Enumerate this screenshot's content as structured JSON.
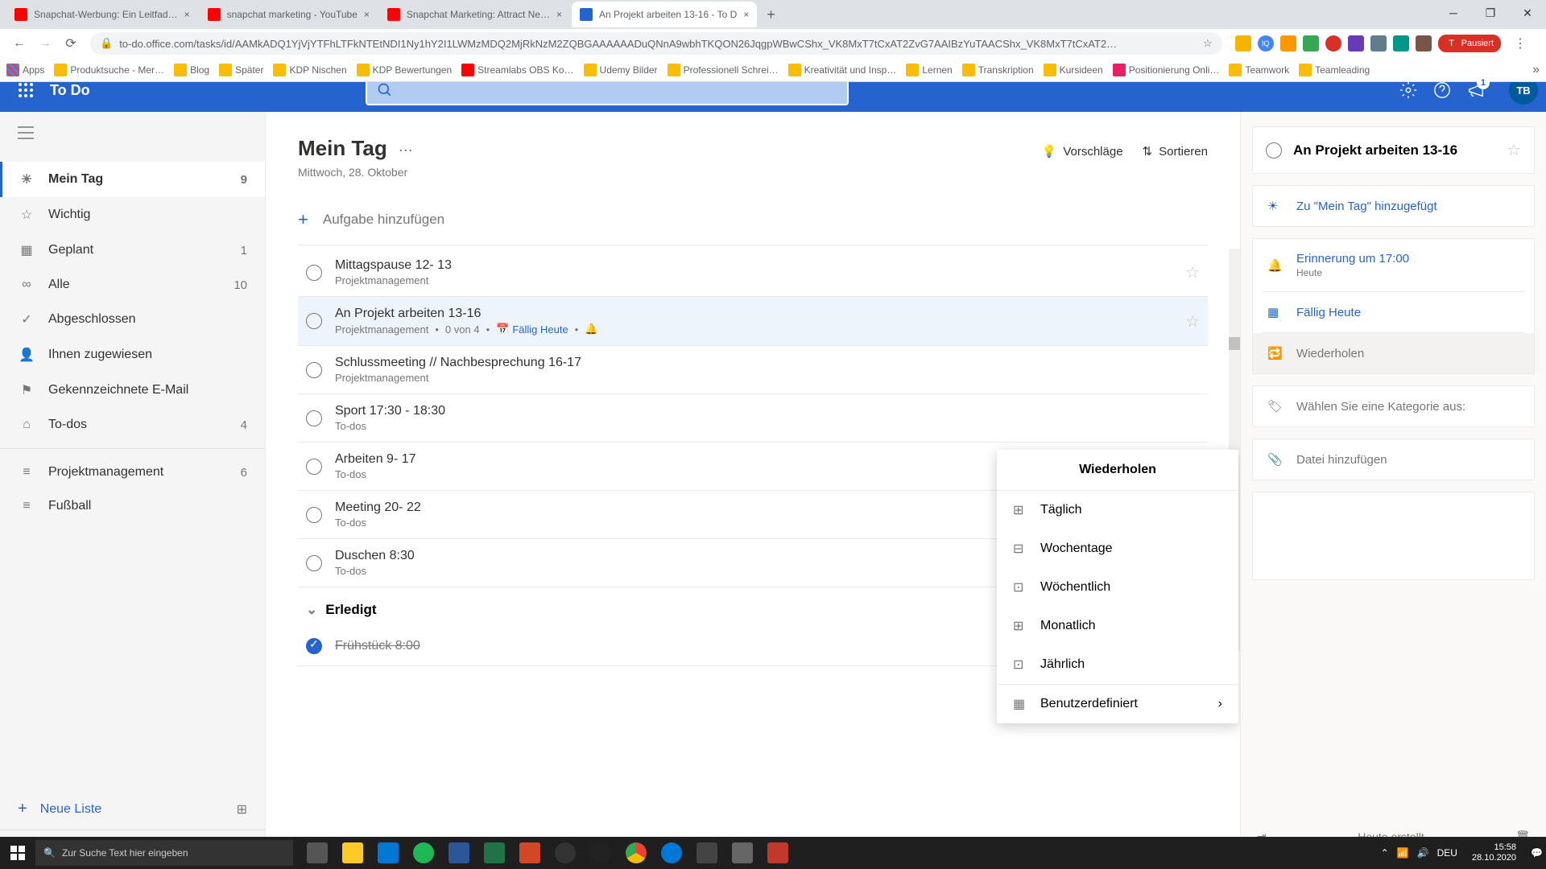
{
  "browser": {
    "tabs": [
      {
        "title": "Snapchat-Werbung: Ein Leitfad…",
        "favicon": "red"
      },
      {
        "title": "snapchat marketing - YouTube",
        "favicon": "red"
      },
      {
        "title": "Snapchat Marketing: Attract Ne…",
        "favicon": "red"
      },
      {
        "title": "An Projekt arbeiten 13-16 - To D",
        "favicon": "blue",
        "active": true
      }
    ],
    "url": "to-do.office.com/tasks/id/AAMkADQ1YjVjYTFhLTFkNTEtNDI1Ny1hY2I1LWMzMDQ2MjRkNzM2ZQBGAAAAAADuQNnA9wbhTKQON26JqgpWBwCShx_VK8MxT7tCxAT2ZvG7AAIBzYuTAACShx_VK8MxT7tCxAT2…",
    "pausiert": "Pausiert",
    "bookmarks": [
      "Apps",
      "Produktsuche - Mer…",
      "Blog",
      "Später",
      "KDP Nischen",
      "KDP Bewertungen",
      "Streamlabs OBS Ko…",
      "Udemy Bilder",
      "Professionell Schrei…",
      "Kreativität und Insp…",
      "Lernen",
      "Transkription",
      "Kursideen",
      "Positionierung Onli…",
      "Teamwork",
      "Teamleading"
    ]
  },
  "app": {
    "title": "To Do",
    "notification_count": "1",
    "avatar": "TB"
  },
  "sidebar": {
    "items": [
      {
        "label": "Mein Tag",
        "count": "9",
        "icon": "sun",
        "active": true
      },
      {
        "label": "Wichtig",
        "count": "",
        "icon": "star"
      },
      {
        "label": "Geplant",
        "count": "1",
        "icon": "calendar"
      },
      {
        "label": "Alle",
        "count": "10",
        "icon": "infinity"
      },
      {
        "label": "Abgeschlossen",
        "count": "",
        "icon": "check-circle"
      },
      {
        "label": "Ihnen zugewiesen",
        "count": "",
        "icon": "user"
      },
      {
        "label": "Gekennzeichnete E-Mail",
        "count": "",
        "icon": "flag"
      },
      {
        "label": "To-dos",
        "count": "4",
        "icon": "home"
      }
    ],
    "lists": [
      {
        "label": "Projektmanagement",
        "count": "6"
      },
      {
        "label": "Fußball",
        "count": ""
      }
    ],
    "new_list": "Neue Liste"
  },
  "content": {
    "title": "Mein Tag",
    "date": "Mittwoch, 28. Oktober",
    "suggestions": "Vorschläge",
    "sort": "Sortieren",
    "add_task": "Aufgabe hinzufügen",
    "tasks": [
      {
        "title": "Mittagspause 12- 13",
        "meta": "Projektmanagement"
      },
      {
        "title": "An Projekt arbeiten 13-16",
        "meta": "Projektmanagement",
        "steps": "0 von 4",
        "due": "Fällig Heute",
        "bell": true,
        "selected": true
      },
      {
        "title": "Schlussmeeting // Nachbesprechung 16-17",
        "meta": "Projektmanagement"
      },
      {
        "title": "Sport 17:30 - 18:30",
        "meta": "To-dos"
      },
      {
        "title": "Arbeiten 9- 17",
        "meta": "To-dos"
      },
      {
        "title": "Meeting 20- 22",
        "meta": "To-dos"
      },
      {
        "title": "Duschen 8:30",
        "meta": "To-dos"
      }
    ],
    "completed_label": "Erledigt",
    "completed": [
      {
        "title": "Frühstück 8:00"
      }
    ]
  },
  "repeat_menu": {
    "title": "Wiederholen",
    "items": [
      "Täglich",
      "Wochentage",
      "Wöchentlich",
      "Monatlich",
      "Jährlich"
    ],
    "custom": "Benutzerdefiniert"
  },
  "details": {
    "title": "An Projekt arbeiten 13-16",
    "added_to_myday": "Zu \"Mein Tag\" hinzugefügt",
    "reminder": "Erinnerung um 17:00",
    "reminder_sub": "Heute",
    "due": "Fällig Heute",
    "repeat": "Wiederholen",
    "category": "Wählen Sie eine Kategorie aus:",
    "attach": "Datei hinzufügen",
    "footer": "Heute erstellt"
  },
  "taskbar": {
    "search_placeholder": "Zur Suche Text hier eingeben",
    "lang": "DEU",
    "time": "15:58",
    "date": "28.10.2020"
  }
}
